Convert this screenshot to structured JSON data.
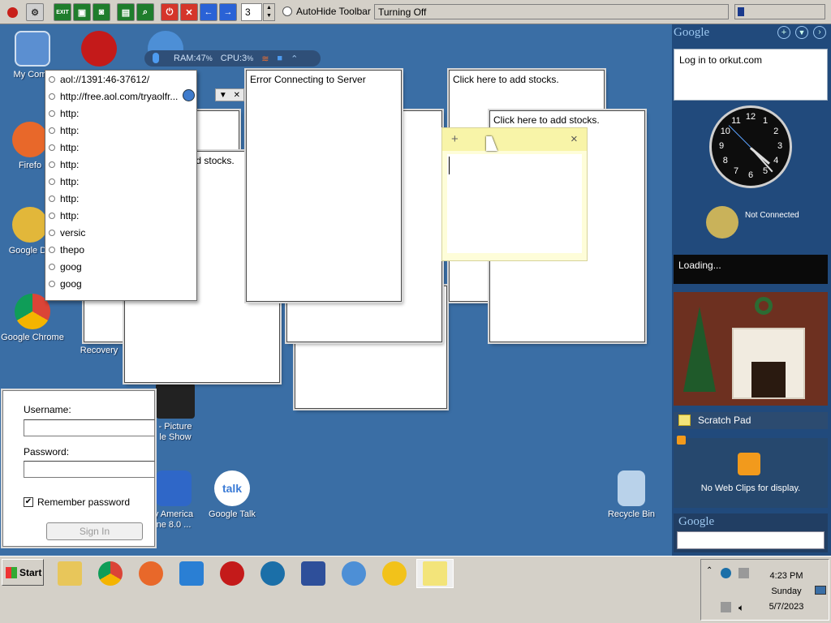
{
  "toolbar": {
    "spin_value": "3",
    "autohide_label": "AutoHide Toolbar",
    "status_text": "Turning Off",
    "progress_value": 0.08,
    "exit_label": "EXIT"
  },
  "sys_monitor": {
    "ram_label": "RAM:",
    "ram_value": "47",
    "cpu_label": "CPU:",
    "cpu_value": "3",
    "unit": "%"
  },
  "desktop_icons": {
    "my_computer": "My Comp",
    "firefox": "Firefo",
    "google_desktop": "Google De",
    "chrome": "Google Chrome",
    "recovery": "Recovery",
    "picture_show_1": "- Picture",
    "picture_show_2": "le Show",
    "america_1": "y America",
    "america_2": "ne 8.0 ...",
    "google_talk": "Google Talk",
    "talk_glyph": "talk",
    "recycle_bin": "Recycle Bin"
  },
  "url_history": [
    "aol://1391:46-37612/",
    "http://free.aol.com/tryaolfr...",
    "http:",
    "http:",
    "http:",
    "http:",
    "http:",
    "http:",
    "http:",
    "versic",
    "thepo",
    "goog",
    "goog"
  ],
  "windows": {
    "stocks_text": "Click here to add stocks.",
    "error_text": "Error Connecting to Server"
  },
  "sticky": {
    "plus": "+",
    "close": "×"
  },
  "login": {
    "username_label": "Username:",
    "password_label": "Password:",
    "remember_label": "Remember password",
    "remember_checked": "✔",
    "signin_label": "Sign In"
  },
  "sidebar": {
    "google_logo": "Google",
    "orkut_text": "Log in to orkut.com",
    "clock_numbers": [
      "12",
      "1",
      "2",
      "3",
      "4",
      "5",
      "6",
      "7",
      "8",
      "9",
      "10",
      "11"
    ],
    "weather_status": "Not Connected",
    "loading_text": "Loading...",
    "scratch_pad_label": "Scratch Pad",
    "webclips_text": "No Web Clips for display.",
    "google_search_logo": "Google"
  },
  "taskbar": {
    "start_label": "Start",
    "time": "4:23 PM",
    "day": "Sunday",
    "date": "5/7/2023"
  },
  "colors": {
    "desktop": "#3a6ea5",
    "toolbar": "#d4d0c8",
    "sidebar": "#214a7c",
    "sticky": "#fefdd9"
  }
}
